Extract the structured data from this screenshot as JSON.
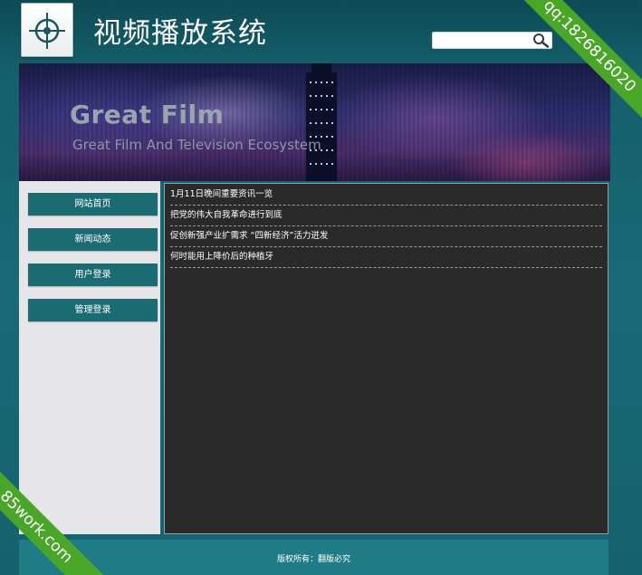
{
  "header": {
    "site_title": "视频播放系统",
    "search": {
      "value": "",
      "placeholder": ""
    },
    "logo_icon": "crosshair-target-icon",
    "search_icon": "magnifier-icon"
  },
  "banner": {
    "title": "Great Film",
    "subtitle": "Great Film And Television Ecosystem"
  },
  "sidebar": {
    "items": [
      {
        "label": "网站首页"
      },
      {
        "label": "新闻动态"
      },
      {
        "label": "用户登录"
      },
      {
        "label": "管理登录"
      }
    ]
  },
  "news": {
    "items": [
      {
        "title": "1月11日晚间重要资讯一览"
      },
      {
        "title": "把党的伟大自我革命进行到底"
      },
      {
        "title": "促创新强产业扩需求 “四新经济”活力迸发"
      },
      {
        "title": "何时能用上降价后的种植牙"
      }
    ]
  },
  "footer": {
    "text": "版权所有：翻版必究"
  },
  "watermarks": {
    "top_right": "qq:1826816020",
    "bottom_left": "85work.com"
  },
  "colors": {
    "nav_bg": "#1a6b72",
    "content_bg": "#2a2a2a",
    "ribbon": "#4aa628",
    "footer_bg": "#1f7c84"
  }
}
